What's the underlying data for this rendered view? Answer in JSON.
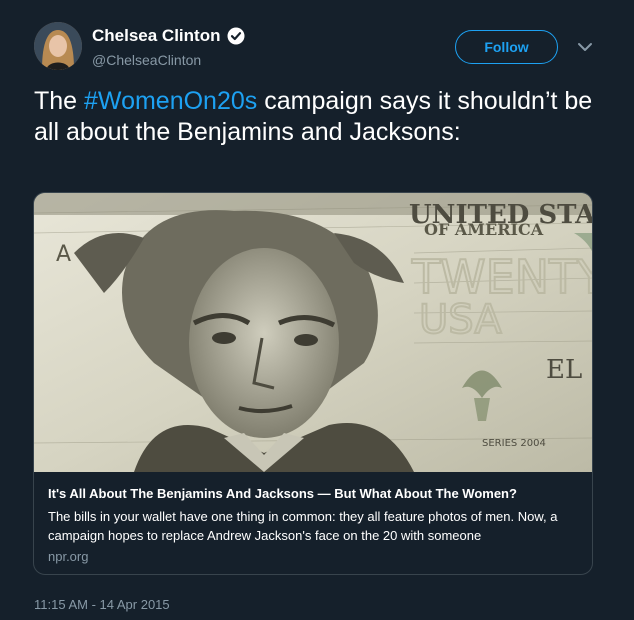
{
  "author": {
    "name": "Chelsea Clinton",
    "handle": "@ChelseaClinton",
    "verified": true
  },
  "follow_button": {
    "label": "Follow"
  },
  "tweet": {
    "text_before": "The ",
    "hashtag": "#WomenOn20s",
    "text_after": " campaign says it shouldn’t be all about the Benjamins and Jacksons:"
  },
  "card": {
    "title": "It's All About The Benjamins And Jacksons — But What About The Women?",
    "description": "The bills in your wallet have one thing in common: they all feature photos of men. Now, a campaign hopes to replace Andrew Jackson's face on the 20 with someone",
    "domain": "npr.org",
    "image_text": {
      "top": "UNITED STATES",
      "sub": "OF AMERICA",
      "letter_a": "A",
      "letter_el": "EL",
      "twenty": "TWENTY",
      "usa": "USA",
      "series": "SERIES 2004"
    }
  },
  "timestamp": "11:15 AM - 14 Apr 2015",
  "colors": {
    "background": "#15202b",
    "accent": "#1da1f2",
    "muted": "#8899a6",
    "border": "#38444d"
  }
}
